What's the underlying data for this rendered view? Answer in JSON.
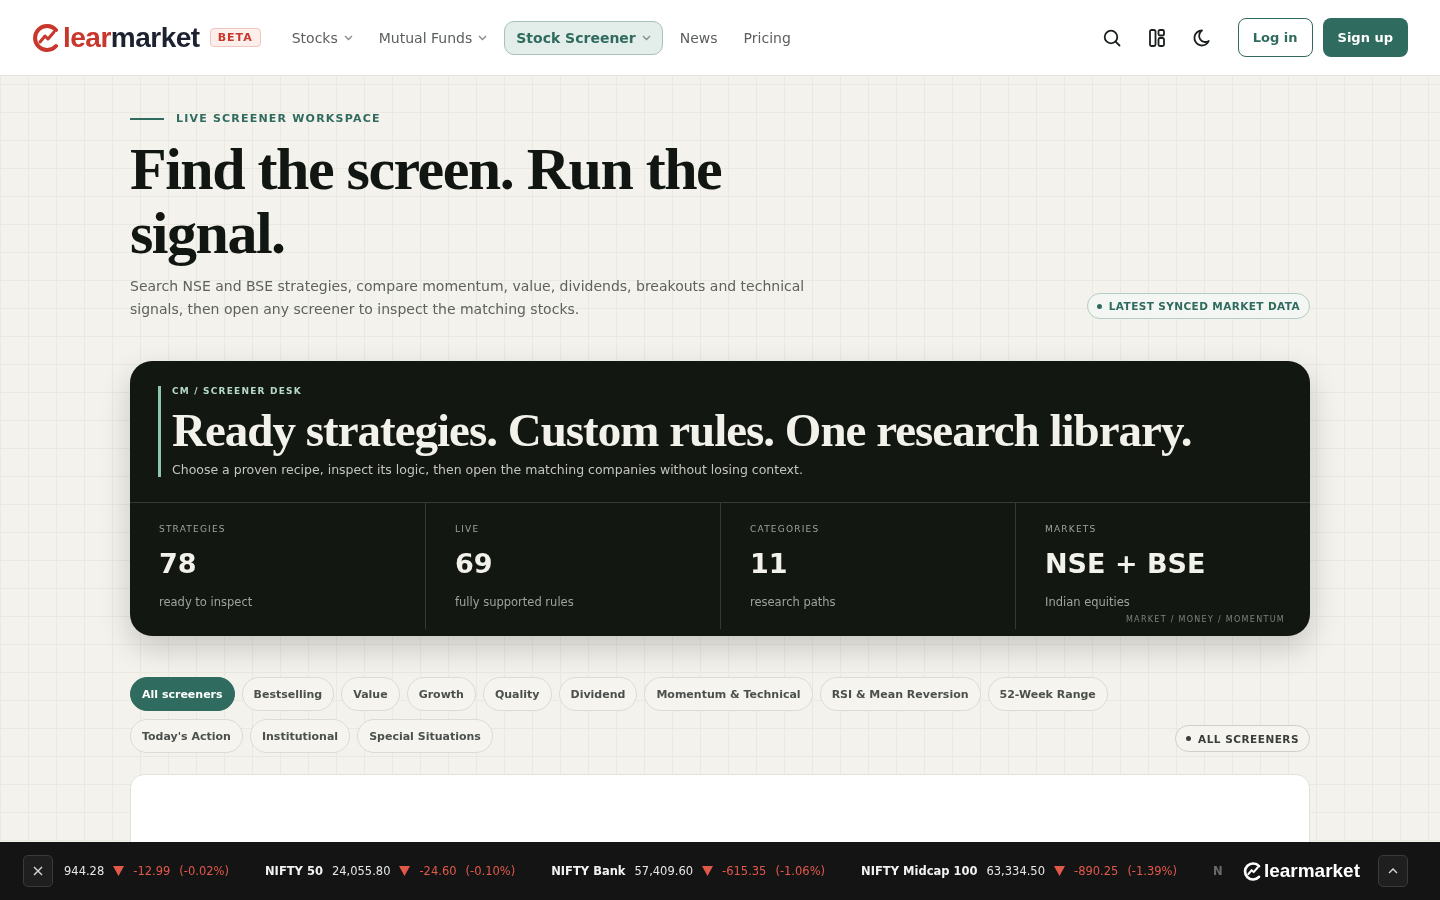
{
  "nav": {
    "logo": {
      "accent": "lear",
      "rest": "market"
    },
    "badge": "BETA",
    "items": [
      {
        "label": "Stocks",
        "dropdown": true,
        "selected": false
      },
      {
        "label": "Mutual Funds",
        "dropdown": true,
        "selected": false
      },
      {
        "label": "Stock Screener",
        "dropdown": true,
        "selected": true
      },
      {
        "label": "News",
        "dropdown": false,
        "selected": false
      },
      {
        "label": "Pricing",
        "dropdown": false,
        "selected": false
      }
    ],
    "login": "Log in",
    "signup": "Sign up"
  },
  "hero": {
    "eyebrow": "LIVE SCREENER WORKSPACE",
    "title": "Find the screen. Run the signal.",
    "subtitle": "Search NSE and BSE strategies, compare momentum, value, dividends, breakouts and technical signals, then open any screener to inspect the matching stocks.",
    "status": "LATEST SYNCED MARKET DATA"
  },
  "desk": {
    "eyebrow": "CM / SCREENER DESK",
    "title": "Ready strategies. Custom rules. One research library.",
    "subtitle": "Choose a proven recipe, inspect its logic, then open the matching companies without losing context.",
    "stats": [
      {
        "label": "STRATEGIES",
        "value": "78",
        "caption": "ready to inspect"
      },
      {
        "label": "LIVE",
        "value": "69",
        "caption": "fully supported rules"
      },
      {
        "label": "CATEGORIES",
        "value": "11",
        "caption": "research paths"
      },
      {
        "label": "MARKETS",
        "value": "NSE + BSE",
        "caption": "Indian equities"
      }
    ],
    "footer": "MARKET / MONEY / MOMENTUM"
  },
  "filters": [
    {
      "label": "All screeners",
      "selected": true
    },
    {
      "label": "Bestselling",
      "selected": false
    },
    {
      "label": "Value",
      "selected": false
    },
    {
      "label": "Growth",
      "selected": false
    },
    {
      "label": "Quality",
      "selected": false
    },
    {
      "label": "Dividend",
      "selected": false
    },
    {
      "label": "Momentum & Technical",
      "selected": false
    },
    {
      "label": "RSI & Mean Reversion",
      "selected": false
    },
    {
      "label": "52-Week Range",
      "selected": false
    },
    {
      "label": "Today's Action",
      "selected": false
    },
    {
      "label": "Institutional",
      "selected": false
    },
    {
      "label": "Special Situations",
      "selected": false
    }
  ],
  "all_screeners": "ALL SCREENERS",
  "ticker": {
    "items": [
      {
        "value": "944.28",
        "kind": "down",
        "change": "-12.99",
        "percent": "(-0.02%)"
      },
      {
        "name": "NIFTY 50",
        "value": "24,055.80",
        "kind": "down",
        "change": "-24.60",
        "percent": "(-0.10%)"
      },
      {
        "name": "NIFTY Bank",
        "value": "57,409.60",
        "kind": "down",
        "change": "-615.35",
        "percent": "(-1.06%)"
      },
      {
        "name": "NIFTY Midcap 100",
        "value": "63,334.50",
        "kind": "down",
        "change": "-890.25",
        "percent": "(-1.39%)"
      },
      {
        "name": "N"
      }
    ],
    "logo": "learmarket"
  }
}
